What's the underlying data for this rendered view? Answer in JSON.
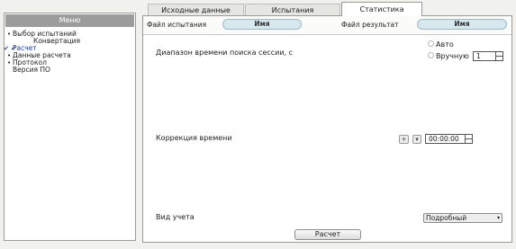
{
  "menu": {
    "title": "Меню",
    "items": [
      {
        "label": "Выбор испытаний",
        "marker": "•"
      },
      {
        "label": "Конвертация",
        "marker": ""
      },
      {
        "label": "Расчет",
        "marker": "✔ ✔"
      },
      {
        "label": "Данные расчета",
        "marker": "•"
      },
      {
        "label": "Протокол",
        "marker": "•"
      },
      {
        "label": "Версия ПО",
        "marker": ""
      }
    ]
  },
  "tabs": [
    {
      "label": "Исходные данные"
    },
    {
      "label": "Испытания"
    },
    {
      "label": "Статистика"
    }
  ],
  "files": {
    "test_file_label": "Файл испытания",
    "test_file_value": "Имя",
    "result_file_label": "Файл результат",
    "result_file_value": "Имя"
  },
  "session_range": {
    "label": "Диапазон времени поиска сессии, с",
    "auto_label": "Авто",
    "manual_label": "Вручную",
    "manual_value": "1"
  },
  "time_correction": {
    "label": "Коррекция времени",
    "sign": "+",
    "value": "00:00:00"
  },
  "accounting": {
    "label": "Вид учета",
    "selected": "Подробный"
  },
  "calculate_label": "Расчет"
}
